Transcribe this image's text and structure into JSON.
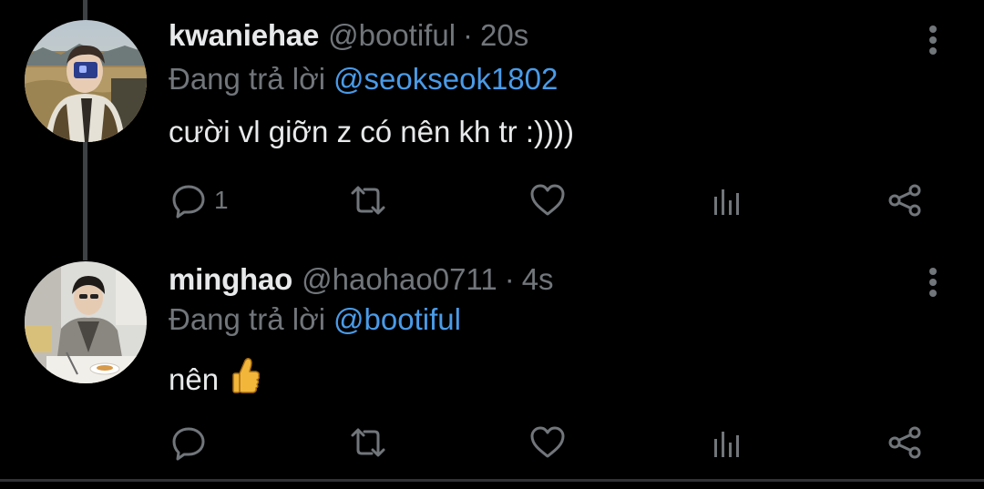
{
  "colors": {
    "background": "#000000",
    "primary_text": "#e7e9ea",
    "secondary_text": "#71767b",
    "mention": "#4a9be8",
    "thread_line": "#3d4144"
  },
  "tweets": [
    {
      "display_name": "kwaniehae",
      "handle": "@bootiful",
      "separator": "·",
      "time": "20s",
      "replying_label": "Đang trả lời",
      "replying_to": "@seokseok1802",
      "text": "cười vl giỡn z có nên kh tr :))))",
      "reply_count": "1",
      "icons": [
        "more-vertical-icon",
        "reply-icon",
        "retweet-icon",
        "like-icon",
        "views-icon",
        "share-icon"
      ]
    },
    {
      "display_name": "minghao",
      "handle": "@haohao0711",
      "separator": "·",
      "time": "4s",
      "replying_label": "Đang trả lời",
      "replying_to": "@bootiful",
      "text": "nên",
      "emoji": "thumbs-up-emoji",
      "icons": [
        "more-vertical-icon",
        "reply-icon",
        "retweet-icon",
        "like-icon",
        "views-icon",
        "share-icon"
      ]
    }
  ]
}
